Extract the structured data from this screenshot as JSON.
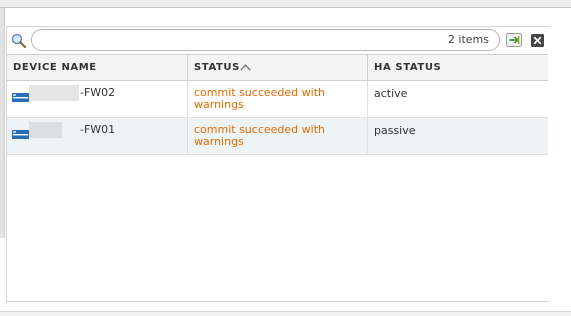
{
  "toolbar": {
    "search_value": "",
    "item_count": "2 items"
  },
  "table": {
    "columns": [
      "DEVICE NAME",
      "STATUS",
      "HA STATUS"
    ],
    "sort": {
      "column": "STATUS",
      "direction": "ascending"
    },
    "rows": [
      {
        "device_name": "-FW02",
        "status": "commit succeeded with warnings",
        "ha_status": "active"
      },
      {
        "device_name": "-FW01",
        "status": "commit succeeded with warnings",
        "ha_status": "passive"
      }
    ]
  },
  "colors": {
    "status_warning": "#e56b00",
    "alt_row": "#eef3f5",
    "device_icon": "#2a6fb5"
  },
  "icons": {
    "search": "search-icon",
    "apply_filter": "apply-filter-icon",
    "clear_filter": "clear-filter-icon",
    "sort": "sort-ascending-icon",
    "device": "firewall-device-icon"
  }
}
